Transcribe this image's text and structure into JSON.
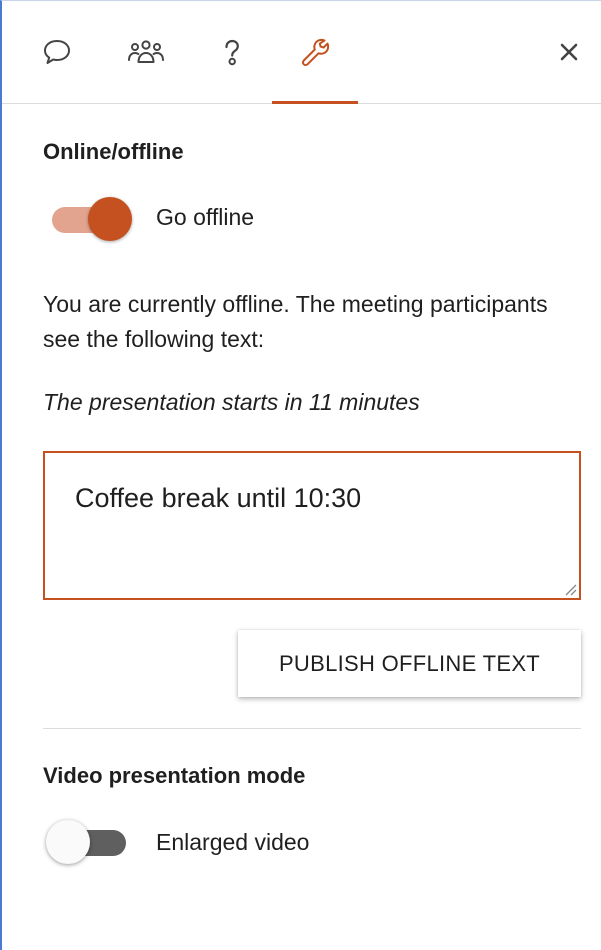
{
  "tabs": [
    {
      "icon": "chat-icon",
      "active": false
    },
    {
      "icon": "participants-icon",
      "active": false
    },
    {
      "icon": "help-icon",
      "active": false
    },
    {
      "icon": "wrench-icon",
      "active": true
    }
  ],
  "close_icon": "close-icon",
  "online_section": {
    "title": "Online/offline",
    "toggle_label": "Go offline",
    "toggle_on": true,
    "status_text": "You are currently offline. The meeting participants see the following text:",
    "current_text": "The presentation starts in 11 minutes",
    "offline_text_value": "Coffee break until 10:30",
    "publish_label": "PUBLISH OFFLINE TEXT"
  },
  "video_section": {
    "title": "Video presentation mode",
    "toggle_label": "Enlarged video",
    "toggle_on": false
  },
  "colors": {
    "accent": "#c4511f",
    "accent_light": "#e3a48f",
    "toggle_off_track": "#5f5f5f",
    "frame_border": "#4a7bd0"
  }
}
